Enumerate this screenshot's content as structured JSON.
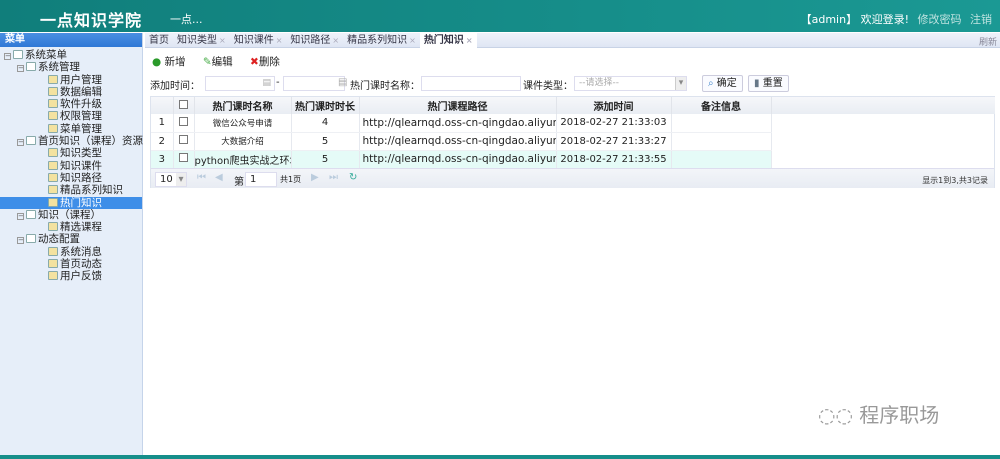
{
  "header": {
    "title": "一点知识学院",
    "subtitle": "一点...",
    "user": "【admin】",
    "welcome": "欢迎登录!",
    "change_password": "修改密码",
    "logout": "注销"
  },
  "sidebar": {
    "heading": "菜单",
    "items": [
      {
        "label": "系统菜单",
        "level": 0,
        "type": "folder"
      },
      {
        "label": "系统管理",
        "level": 1,
        "type": "folder"
      },
      {
        "label": "用户管理",
        "level": 2
      },
      {
        "label": "数据编辑",
        "level": 2
      },
      {
        "label": "软件升级",
        "level": 2
      },
      {
        "label": "权限管理",
        "level": 2
      },
      {
        "label": "菜单管理",
        "level": 2
      },
      {
        "label": "首页知识（课程）资源",
        "level": 1,
        "type": "folder"
      },
      {
        "label": "知识类型",
        "level": 2
      },
      {
        "label": "知识课件",
        "level": 2
      },
      {
        "label": "知识路径",
        "level": 2
      },
      {
        "label": "精品系列知识",
        "level": 2
      },
      {
        "label": "热门知识",
        "level": 2,
        "selected": true
      },
      {
        "label": "知识（课程）",
        "level": 1,
        "type": "folder"
      },
      {
        "label": "精选课程",
        "level": 2
      },
      {
        "label": "动态配置",
        "level": 1,
        "type": "folder"
      },
      {
        "label": "系统消息",
        "level": 2
      },
      {
        "label": "首页动态",
        "level": 2
      },
      {
        "label": "用户反馈",
        "level": 2
      }
    ]
  },
  "tabs": [
    {
      "label": "首页",
      "closable": false
    },
    {
      "label": "知识类型",
      "closable": true
    },
    {
      "label": "知识课件",
      "closable": true
    },
    {
      "label": "知识路径",
      "closable": true
    },
    {
      "label": "精品系列知识",
      "closable": true
    },
    {
      "label": "热门知识",
      "closable": true,
      "active": true
    }
  ],
  "tabs_close": "×",
  "refresh": "刷新",
  "toolbar": {
    "add": "新增",
    "edit": "编辑",
    "delete": "删除"
  },
  "filters": {
    "add_time_label": "添加时间：",
    "dash": "-",
    "name_label": "热门课时名称：",
    "type_label": "课件类型：",
    "type_placeholder": "--请选择--",
    "confirm": "确定",
    "reset": "重置"
  },
  "table": {
    "columns": [
      "热门课时名称",
      "热门课时时长",
      "热门课程路径",
      "添加时间",
      "备注信息"
    ],
    "rows": [
      {
        "no": "1",
        "name": "微信公众号申请",
        "duration": "4",
        "path": "http://qlearnqd.oss-cn-qingdao.aliyuncs.c",
        "time": "2018-02-27 21:33:03",
        "note": ""
      },
      {
        "no": "2",
        "name": "大数据介绍",
        "duration": "5",
        "path": "http://qlearnqd.oss-cn-qingdao.aliyuncs.c",
        "time": "2018-02-27 21:33:27",
        "note": ""
      },
      {
        "no": "3",
        "name": "python爬虫实战之环境",
        "duration": "5",
        "path": "http://qlearnqd.oss-cn-qingdao.aliyuncs.c",
        "time": "2018-02-27 21:33:55",
        "note": ""
      }
    ]
  },
  "pager": {
    "page_size": "10",
    "page_label": "第",
    "page": "1",
    "total_pages": "共1页",
    "info": "显示1到3,共3记录"
  },
  "watermark": "程序职场"
}
